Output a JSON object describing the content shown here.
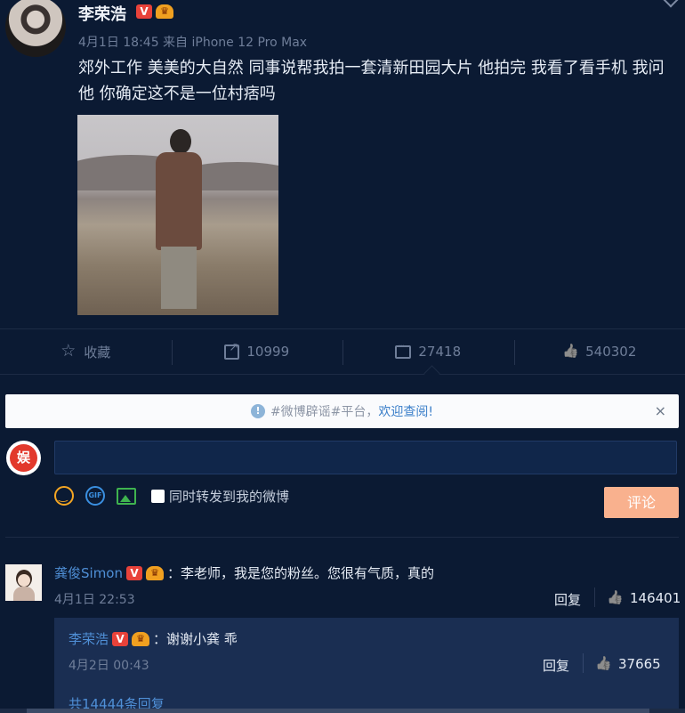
{
  "post": {
    "author": "李荣浩",
    "meta": "4月1日 18:45 来自 iPhone 12 Pro Max",
    "text": "郊外工作 美美的大自然 同事说帮我拍一套清新田园大片 他拍完 我看了看手机 我问他 你确定这不是一位村痞吗",
    "badge_v": "V"
  },
  "actions": {
    "favorite": "收藏",
    "repost": "10999",
    "comment": "27418",
    "like": "540302"
  },
  "notice": {
    "text": "#微博辟谣#平台，",
    "link": "欢迎查阅!",
    "close": "×"
  },
  "composer": {
    "placeholder": "",
    "gif": "GIF",
    "repost_label": "同时转发到我的微博",
    "submit": "评论",
    "avatar_text": "娱"
  },
  "comment": {
    "user": "龚俊Simon",
    "text": "：李老师，我是您的粉丝。您很有气质，真的",
    "date": "4月1日 22:53",
    "reply": "回复",
    "likes": "146401"
  },
  "sub_reply": {
    "user": "李荣浩",
    "text": "：谢谢小龚 乖",
    "date": "4月2日 00:43",
    "reply": "回复",
    "likes": "37665",
    "more": "共14444条回复"
  },
  "colors": {
    "background": "#0b1a33",
    "link": "#4f8fd6",
    "submit": "#f9b18e"
  }
}
